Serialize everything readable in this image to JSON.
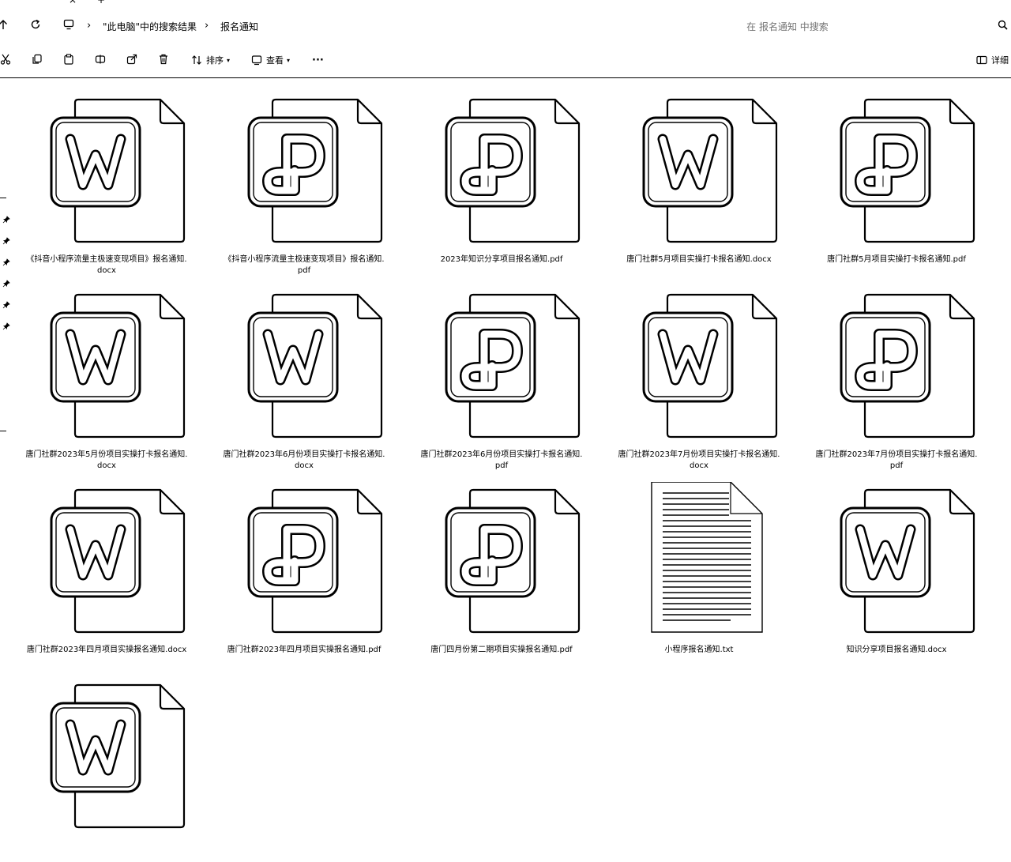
{
  "tabstrip": {
    "close_glyph": "×",
    "new_tab_glyph": "+"
  },
  "address_bar": {
    "up_icon": "up-arrow-icon",
    "refresh_icon": "refresh-icon",
    "breadcrumbs": [
      "\"此电脑\"中的搜索结果",
      "报名通知"
    ],
    "search_placeholder": "在 报名通知 中搜索",
    "search_icon": "search-icon"
  },
  "toolbar": {
    "sort_label": "排序",
    "view_label": "查看",
    "more_label": "···",
    "details_label": "详细"
  },
  "files": [
    {
      "name": "《抖音小程序流量主极速变现项目》报名通知.\ndocx",
      "type": "docx"
    },
    {
      "name": "《抖音小程序流量主极速变现项目》报名通知.\npdf",
      "type": "pdf"
    },
    {
      "name": "2023年知识分享项目报名通知.pdf",
      "type": "pdf"
    },
    {
      "name": "唐门社群5月项目实操打卡报名通知.docx",
      "type": "docx"
    },
    {
      "name": "唐门社群5月项目实操打卡报名通知.pdf",
      "type": "pdf"
    },
    {
      "name": "唐门社群2023年5月份项目实操打卡报名通知.\ndocx",
      "type": "docx"
    },
    {
      "name": "唐门社群2023年6月份项目实操打卡报名通知.\ndocx",
      "type": "docx"
    },
    {
      "name": "唐门社群2023年6月份项目实操打卡报名通知.\npdf",
      "type": "pdf"
    },
    {
      "name": "唐门社群2023年7月份项目实操打卡报名通知.\ndocx",
      "type": "docx"
    },
    {
      "name": "唐门社群2023年7月份项目实操打卡报名通知.\npdf",
      "type": "pdf"
    },
    {
      "name": "唐门社群2023年四月项目实操报名通知.docx",
      "type": "docx"
    },
    {
      "name": "唐门社群2023年四月项目实操报名通知.pdf",
      "type": "pdf"
    },
    {
      "name": "唐门四月份第二期项目实操报名通知.pdf",
      "type": "pdf"
    },
    {
      "name": "小程序报名通知.txt",
      "type": "txt"
    },
    {
      "name": "知识分享项目报名通知.docx",
      "type": "docx"
    },
    {
      "name": "",
      "type": "docx"
    }
  ]
}
